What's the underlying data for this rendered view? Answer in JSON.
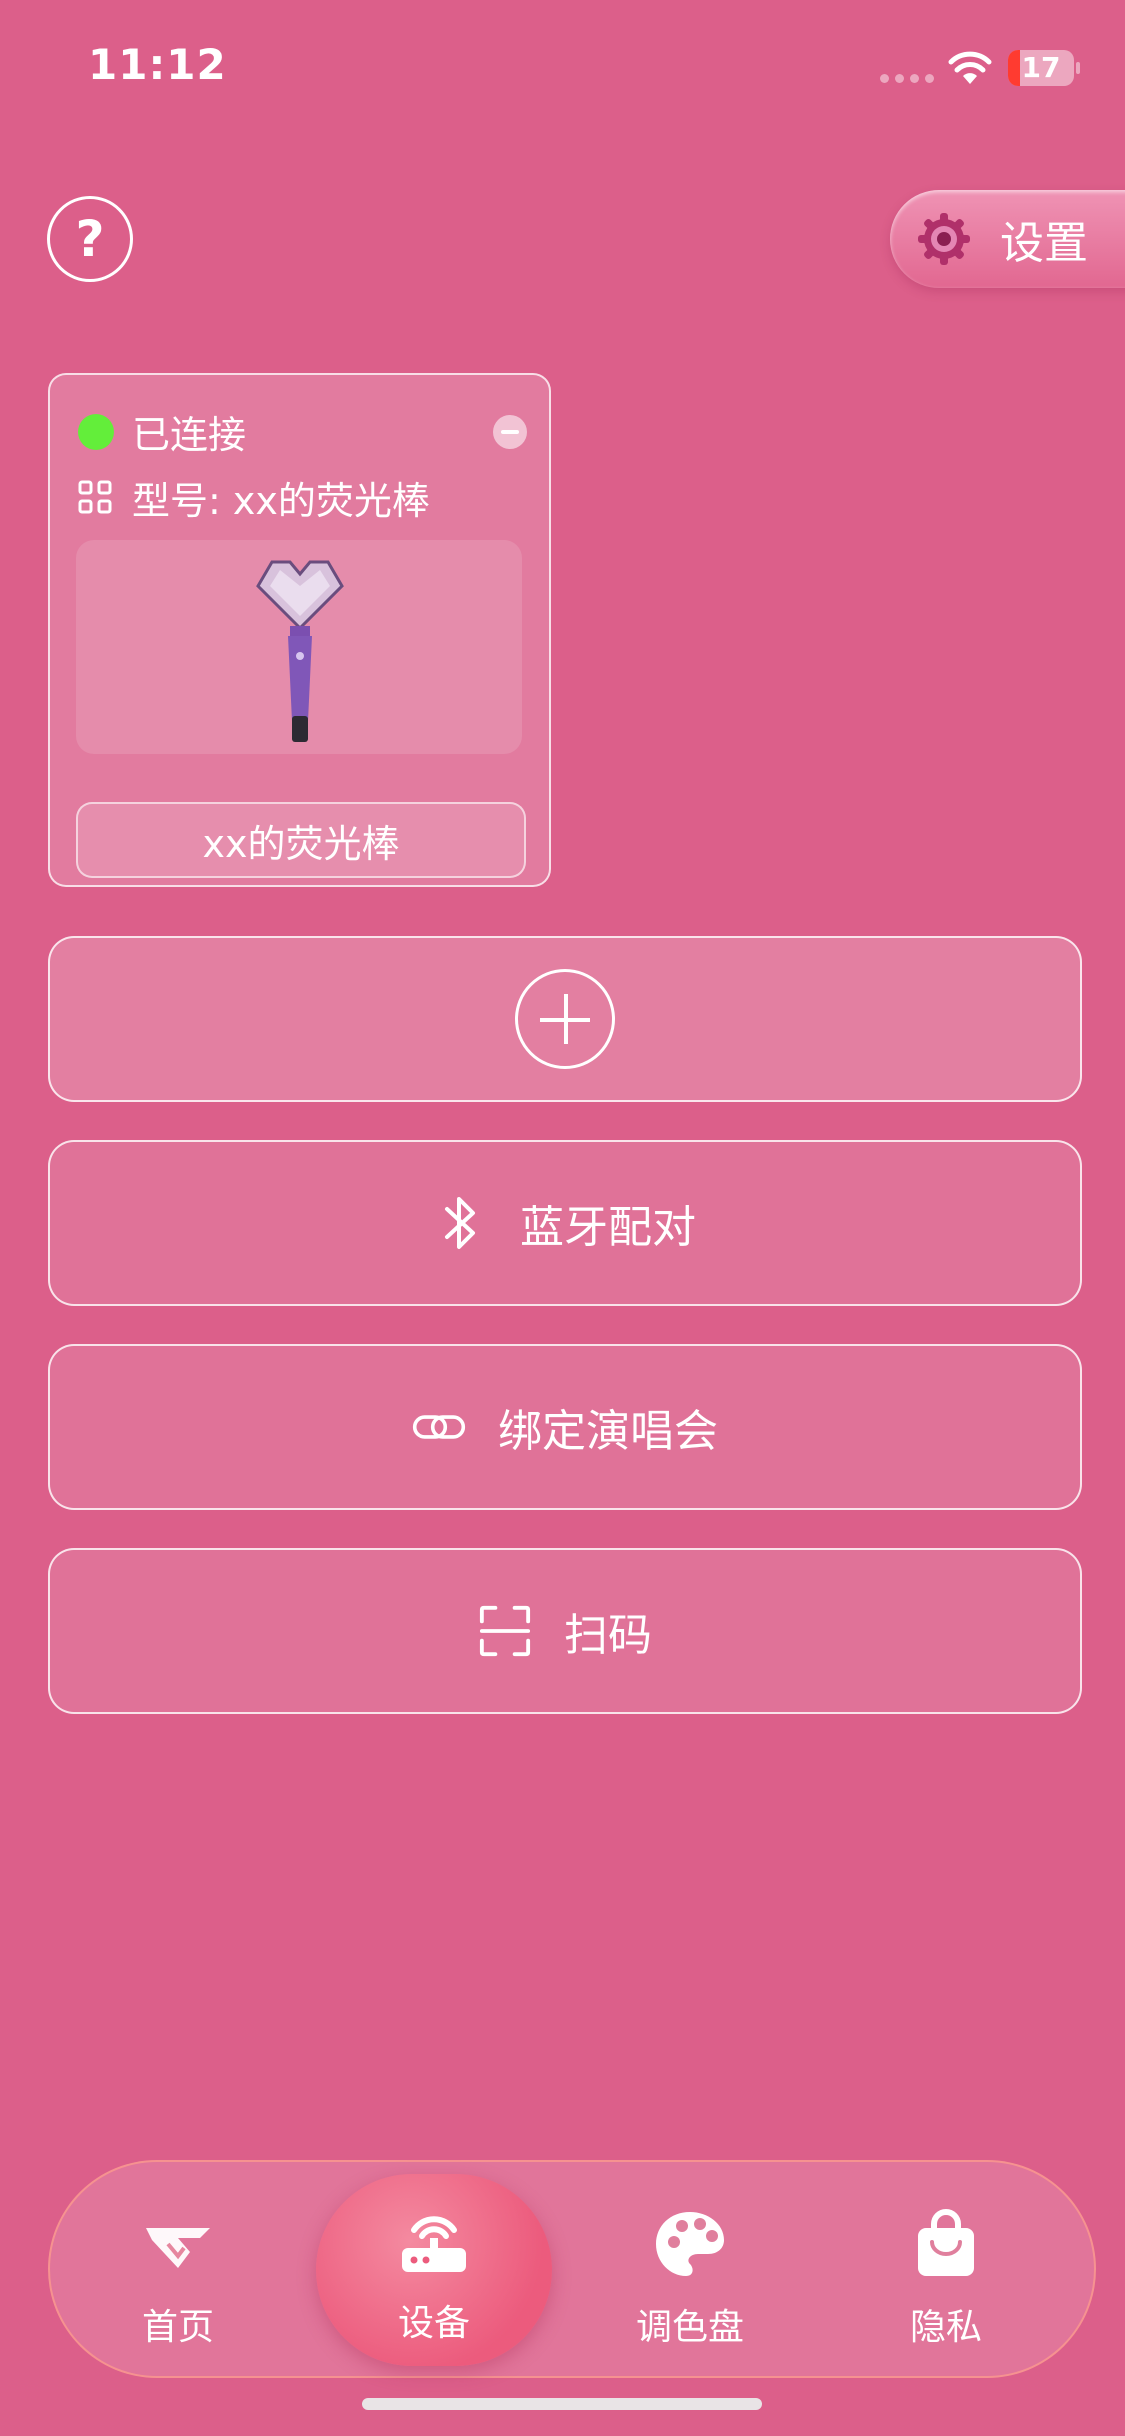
{
  "status_bar": {
    "time": "11:12",
    "battery": "17"
  },
  "header": {
    "settings_label": "设置",
    "help_icon": "question-icon",
    "settings_icon": "gear-icon"
  },
  "device_card": {
    "status": "已连接",
    "status_color": "#63ee3a",
    "model_label": "型号: xx的荧光棒",
    "name": "xx的荧光棒"
  },
  "actions": [
    {
      "label": "",
      "icon": "plus-circle-icon"
    },
    {
      "label": "蓝牙配对",
      "icon": "bluetooth-icon"
    },
    {
      "label": "绑定演唱会",
      "icon": "link-icon"
    },
    {
      "label": "扫码",
      "icon": "scan-icon"
    }
  ],
  "tabs": [
    {
      "label": "首页",
      "icon": "logo-icon",
      "active": false
    },
    {
      "label": "设备",
      "icon": "router-icon",
      "active": true
    },
    {
      "label": "调色盘",
      "icon": "palette-icon",
      "active": false
    },
    {
      "label": "隐私",
      "icon": "bag-icon",
      "active": false
    }
  ],
  "colors": {
    "background": "#dc5f8a",
    "active_tab": "#ec5b7d"
  }
}
